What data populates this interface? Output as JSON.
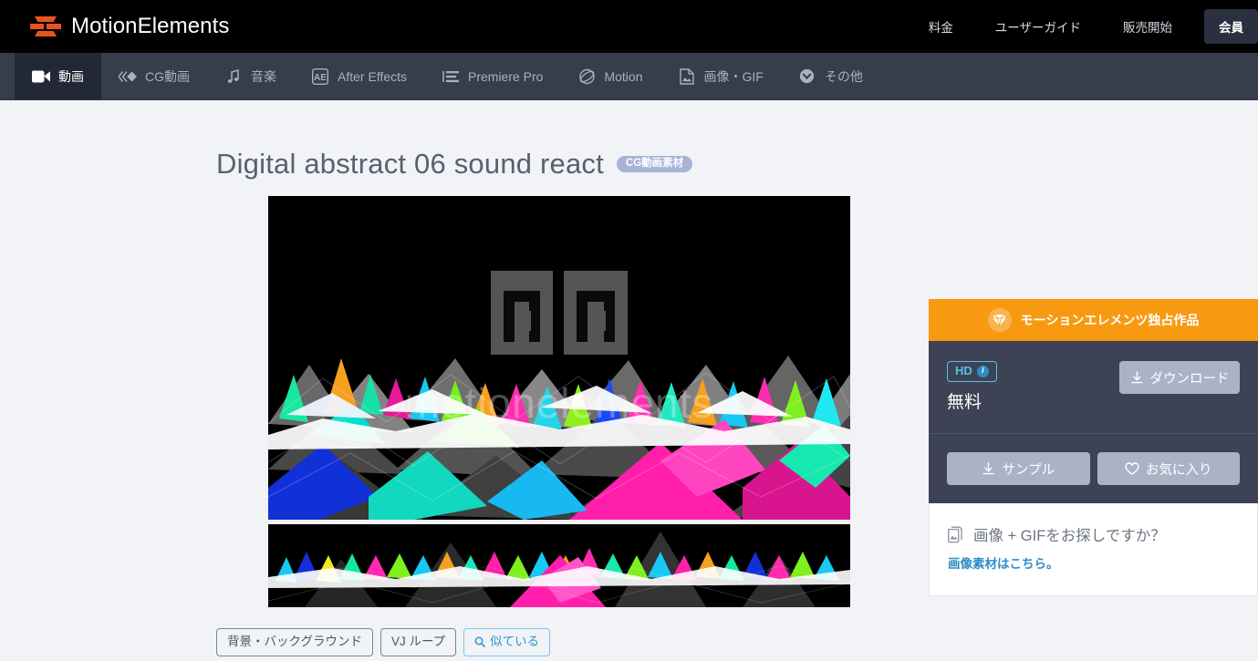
{
  "header": {
    "brand": "MotionElements",
    "links": [
      {
        "label": "料金"
      },
      {
        "label": "ユーザーガイド"
      },
      {
        "label": "販売開始"
      }
    ],
    "member_button": "会員"
  },
  "subnav": {
    "items": [
      {
        "label": "動画",
        "icon": "video-camera-icon",
        "active": true
      },
      {
        "label": "CG動画",
        "icon": "cg-chevrons-icon",
        "active": false
      },
      {
        "label": "音楽",
        "icon": "music-note-icon",
        "active": false
      },
      {
        "label": "After Effects",
        "icon": "after-effects-icon",
        "active": false
      },
      {
        "label": "Premiere Pro",
        "icon": "premiere-pro-icon",
        "active": false
      },
      {
        "label": "Motion",
        "icon": "motion-orbit-icon",
        "active": false
      },
      {
        "label": "画像・GIF",
        "icon": "image-file-icon",
        "active": false
      },
      {
        "label": "その他",
        "icon": "chevron-down-circle-icon",
        "active": false
      }
    ]
  },
  "main": {
    "title": "Digital abstract 06 sound react",
    "title_badge": "CG動画素材",
    "preview": {
      "watermark_text": "motionelements",
      "watermark_logo": "motionelements-spiral-logo"
    },
    "tags": [
      {
        "label": "背景・バックグラウンド",
        "icon": null
      },
      {
        "label": "VJ ループ",
        "icon": null
      },
      {
        "label": "似ている",
        "icon": "search-icon"
      }
    ]
  },
  "sidebar": {
    "exclusive_banner": {
      "label": "モーションエレメンツ独占作品",
      "icon": "diamond-icon",
      "color": "#f79a11"
    },
    "quality_badge": "HD",
    "quality_info_icon": "info-icon",
    "price": "無料",
    "download_button": {
      "label": "ダウンロード",
      "icon": "download-icon"
    },
    "sample_button": {
      "label": "サンプル",
      "icon": "download-icon"
    },
    "favorite_button": {
      "label": "お気に入り",
      "icon": "heart-icon"
    },
    "promo_card": {
      "heading": "画像 + GIFをお探しですか？",
      "icon": "images-stack-icon",
      "link": "画像素材はこちら。"
    }
  },
  "colors": {
    "page_bg": "#f1f3f7",
    "topbar_bg": "#000000",
    "subnav_bg": "#373d4d",
    "subnav_active_bg": "#232836",
    "brand_orange": "#e8541e",
    "exclusive_orange": "#f79a11",
    "panel_dark": "#3d4354",
    "accent_blue": "#2d8dc4",
    "hd_cyan": "#56c1ea",
    "button_muted": "#aab3c6"
  }
}
